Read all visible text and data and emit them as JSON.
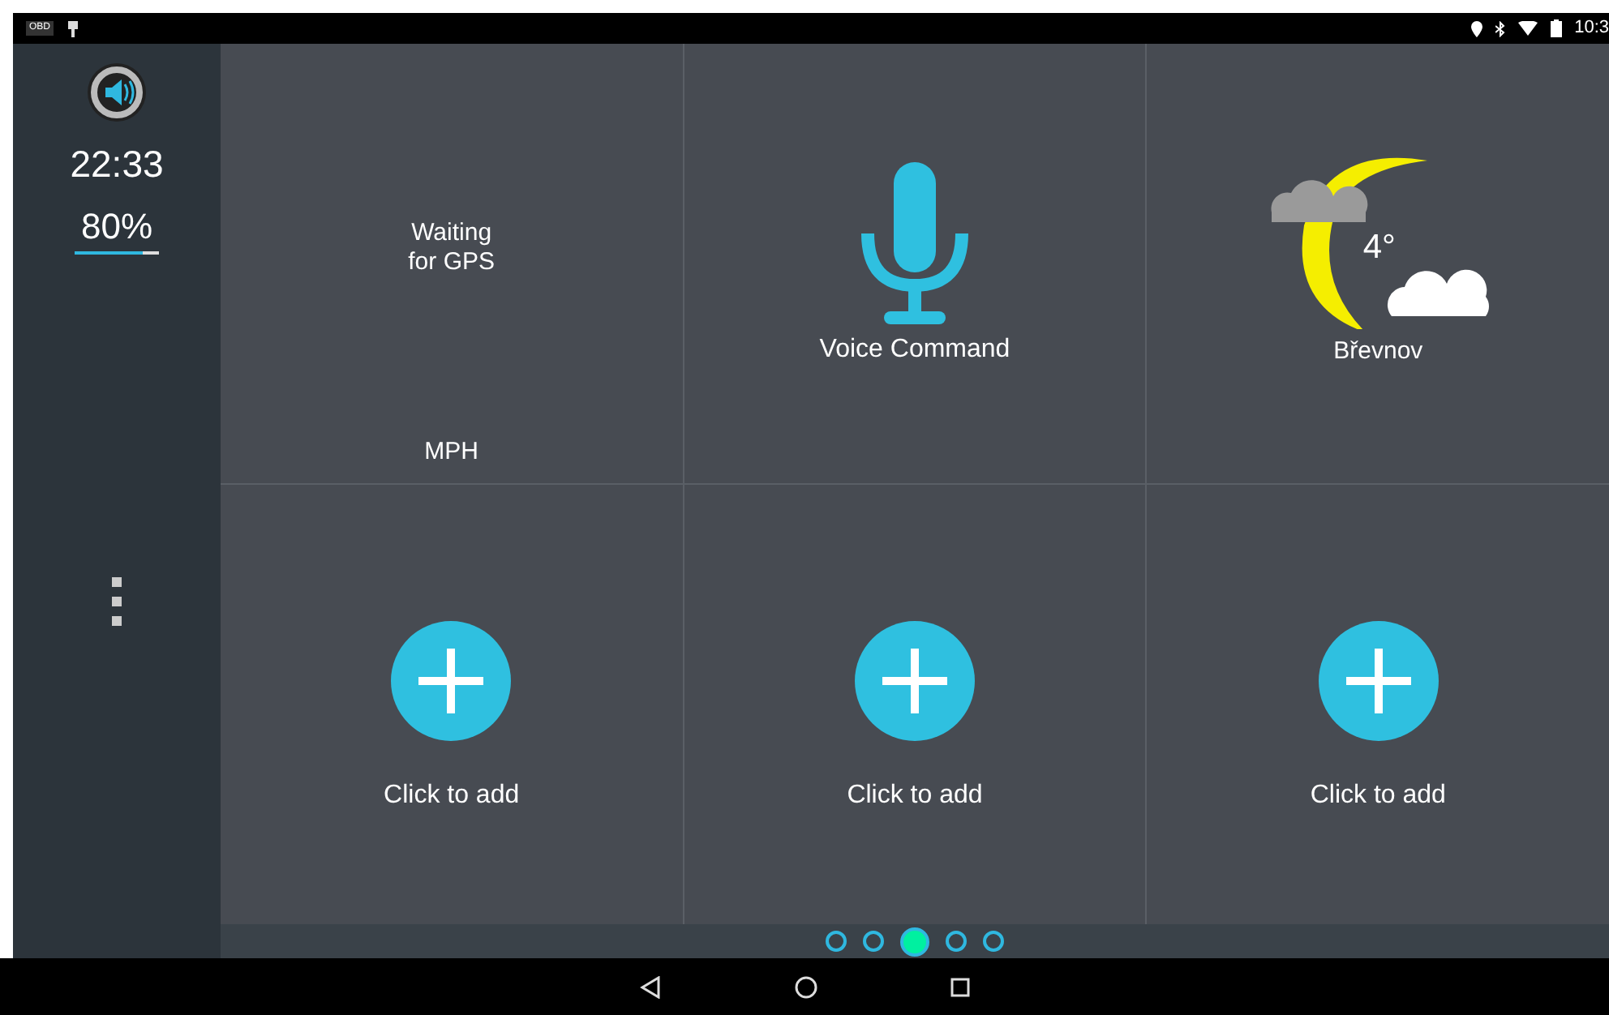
{
  "status_bar": {
    "obd_badge": "OBD",
    "time": "10:3"
  },
  "sidebar": {
    "clock": "22:33",
    "battery": "80%",
    "level": 0.8
  },
  "tiles": [
    {
      "kind": "speed",
      "status": "Waiting\nfor GPS",
      "unit": "MPH"
    },
    {
      "kind": "voice",
      "label": "Voice Command"
    },
    {
      "kind": "weather",
      "temperature": "4°",
      "location": "Břevnov"
    },
    {
      "kind": "add",
      "label": "Click to add"
    },
    {
      "kind": "add",
      "label": "Click to add"
    },
    {
      "kind": "add",
      "label": "Click to add"
    }
  ],
  "pager": [
    {
      "selected": false
    },
    {
      "selected": false
    },
    {
      "selected": true
    },
    {
      "selected": false
    },
    {
      "selected": false
    }
  ]
}
